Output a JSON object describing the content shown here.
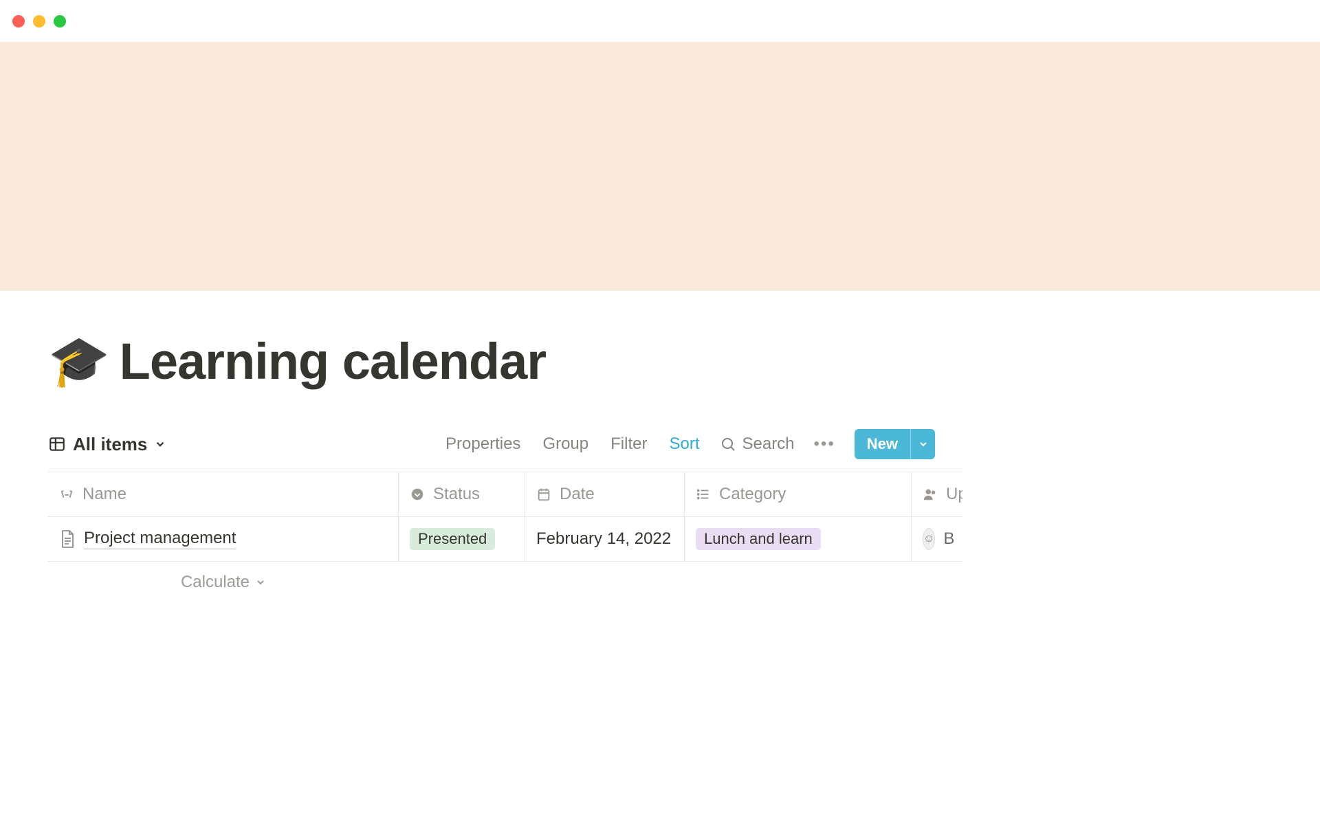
{
  "page": {
    "emoji": "🎓",
    "title": "Learning calendar"
  },
  "toolbar": {
    "view_label": "All items",
    "properties": "Properties",
    "group": "Group",
    "filter": "Filter",
    "sort": "Sort",
    "search": "Search",
    "new": "New"
  },
  "columns": {
    "name": "Name",
    "status": "Status",
    "date": "Date",
    "category": "Category",
    "up": "Up"
  },
  "rows": [
    {
      "title": "Project management",
      "status": "Presented",
      "date": "February 14, 2022",
      "category": "Lunch and learn",
      "up_initial": "B"
    }
  ],
  "footer": {
    "calculate": "Calculate"
  }
}
